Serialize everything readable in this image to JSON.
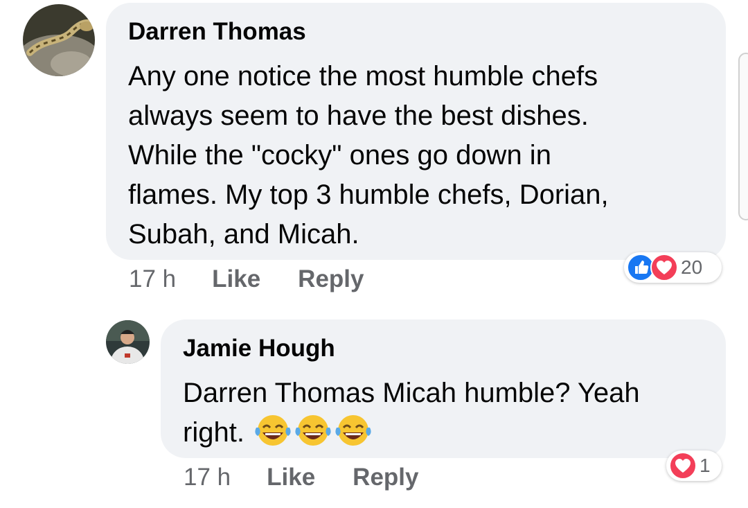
{
  "comments": [
    {
      "author": "Darren Thomas",
      "text_lines": [
        "Any one notice the most humble chefs",
        "always seem to have the best dishes.",
        "While the \"cocky\" ones go down in",
        "flames. My top 3 humble chefs, Dorian,",
        "Subah, and Micah."
      ],
      "time": "17 h",
      "like_label": "Like",
      "reply_label": "Reply",
      "reaction_count": "20",
      "reaction_icons": [
        "like-icon",
        "love-icon"
      ]
    },
    {
      "author": "Jamie Hough",
      "text_line1": "Darren Thomas Micah humble? Yeah",
      "text_line2": "right.",
      "emoji_icons": [
        "tears-of-joy-emoji",
        "tears-of-joy-emoji",
        "tears-of-joy-emoji"
      ],
      "time": "17 h",
      "like_label": "Like",
      "reply_label": "Reply",
      "reaction_count": "1",
      "reaction_icons": [
        "love-icon"
      ]
    }
  ],
  "colors": {
    "bubble": "#f0f2f5",
    "meta_text": "#65676b",
    "like_blue": "#1877f2",
    "love_red": "#f33e58"
  }
}
